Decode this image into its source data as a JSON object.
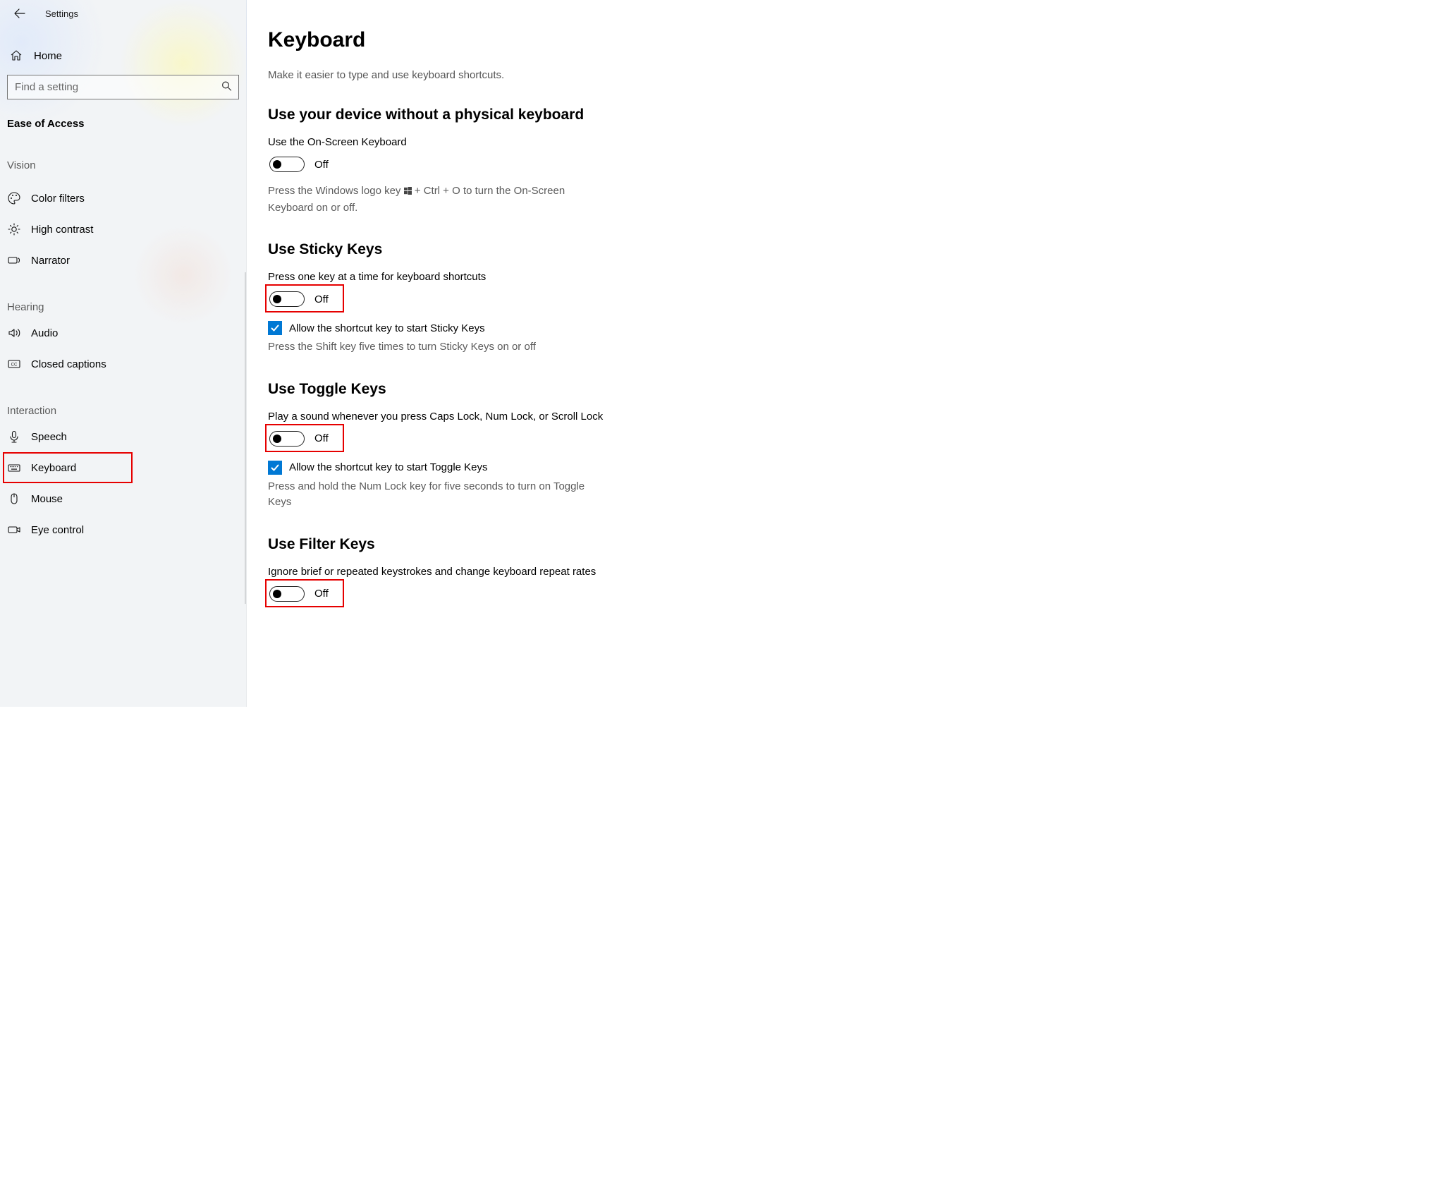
{
  "window": {
    "title": "Settings"
  },
  "sidebar": {
    "home_label": "Home",
    "search_placeholder": "Find a setting",
    "category": "Ease of Access",
    "groups": [
      {
        "label": "Vision",
        "items": [
          {
            "id": "color-filters",
            "label": "Color filters"
          },
          {
            "id": "high-contrast",
            "label": "High contrast"
          },
          {
            "id": "narrator",
            "label": "Narrator"
          }
        ]
      },
      {
        "label": "Hearing",
        "items": [
          {
            "id": "audio",
            "label": "Audio"
          },
          {
            "id": "closed-captions",
            "label": "Closed captions"
          }
        ]
      },
      {
        "label": "Interaction",
        "items": [
          {
            "id": "speech",
            "label": "Speech"
          },
          {
            "id": "keyboard",
            "label": "Keyboard"
          },
          {
            "id": "mouse",
            "label": "Mouse"
          },
          {
            "id": "eye-control",
            "label": "Eye control"
          }
        ]
      }
    ]
  },
  "main": {
    "title": "Keyboard",
    "subtitle": "Make it easier to type and use keyboard shortcuts.",
    "osk": {
      "heading": "Use your device without a physical keyboard",
      "label": "Use the On-Screen Keyboard",
      "state": "Off",
      "hint_pre": "Press the Windows logo key ",
      "hint_post": " + Ctrl + O to turn the On-Screen Keyboard on or off."
    },
    "sticky": {
      "heading": "Use Sticky Keys",
      "label": "Press one key at a time for keyboard shortcuts",
      "state": "Off",
      "checkbox_label": "Allow the shortcut key to start Sticky Keys",
      "hint": "Press the Shift key five times to turn Sticky Keys on or off"
    },
    "toggle_keys": {
      "heading": "Use Toggle Keys",
      "label": "Play a sound whenever you press Caps Lock, Num Lock, or Scroll Lock",
      "state": "Off",
      "checkbox_label": "Allow the shortcut key to start Toggle Keys",
      "hint": "Press and hold the Num Lock key for five seconds to turn on Toggle Keys"
    },
    "filter": {
      "heading": "Use Filter Keys",
      "label": "Ignore brief or repeated keystrokes and change keyboard repeat rates",
      "state": "Off"
    }
  }
}
